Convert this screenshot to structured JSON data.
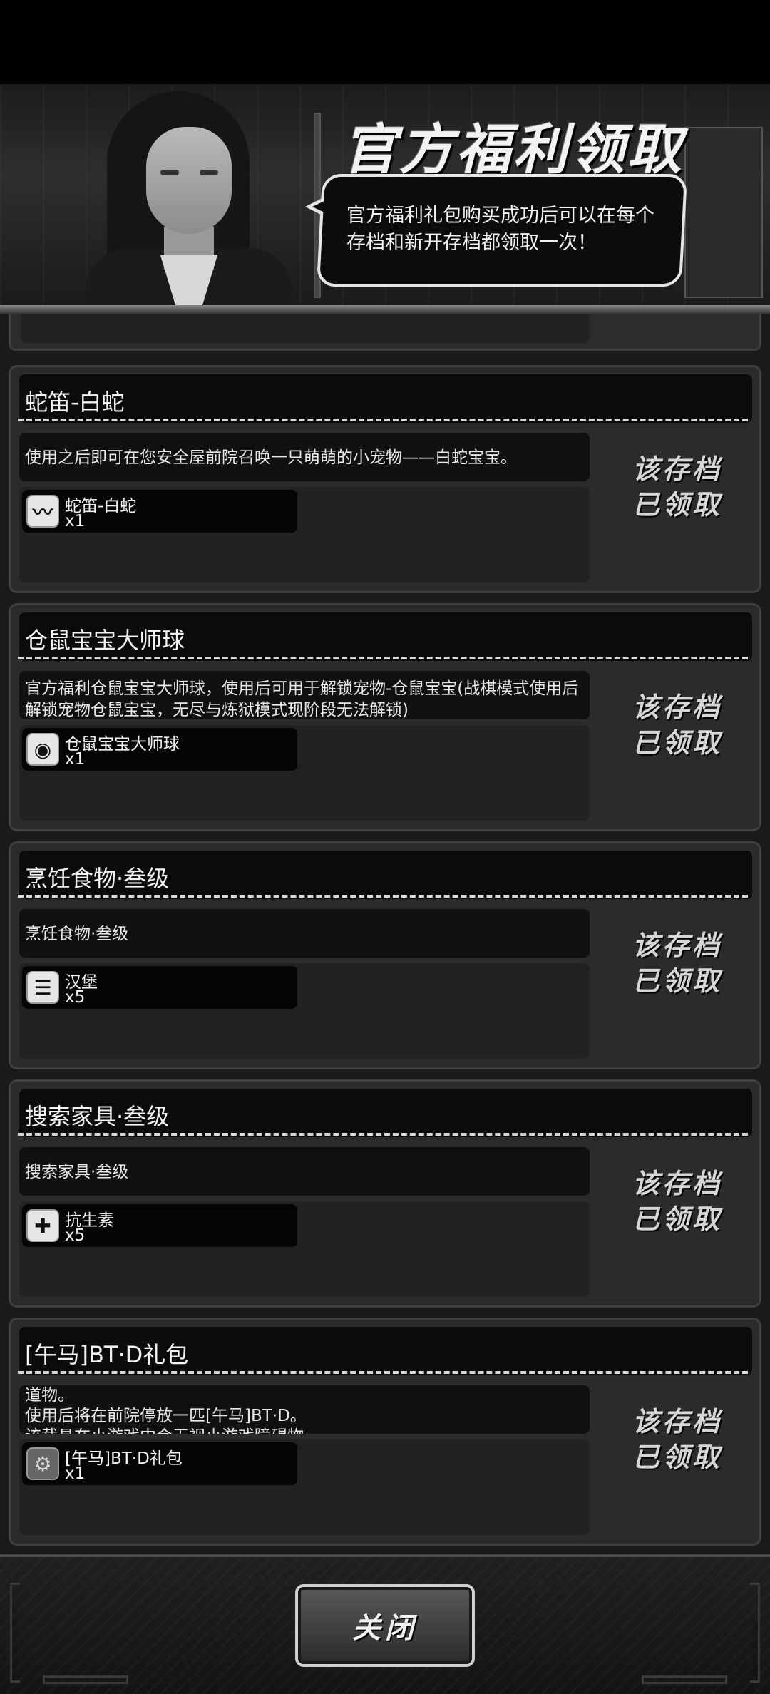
{
  "header": {
    "title": "官方福利领取",
    "bubble_text": "官方福利礼包购买成功后可以在每个存档和新开存档都领取一次！"
  },
  "cards": [
    {
      "title": "蛇笛-白蛇",
      "description": "使用之后即可在您安全屋前院召唤一只萌萌的小宠物——白蛇宝宝。",
      "item": {
        "name": "蛇笛-白蛇",
        "count": "x1",
        "icon": "snake-flute-icon"
      },
      "status": "该存档已领取"
    },
    {
      "title": "仓鼠宝宝大师球",
      "description": "官方福利仓鼠宝宝大师球，使用后可用于解锁宠物-仓鼠宝宝(战棋模式使用后解锁宠物仓鼠宝宝，无尽与炼狱模式现阶段无法解锁)",
      "item": {
        "name": "仓鼠宝宝大师球",
        "count": "x1",
        "icon": "master-ball-icon"
      },
      "status": "该存档已领取"
    },
    {
      "title": "烹饪食物·叁级",
      "description": "烹饪食物·叁级",
      "item": {
        "name": "汉堡",
        "count": "x5",
        "icon": "burger-icon"
      },
      "status": "该存档已领取"
    },
    {
      "title": "搜索家具·叁级",
      "description": "搜索家具·叁级",
      "item": {
        "name": "抗生素",
        "count": "x5",
        "icon": "antibiotic-icon"
      },
      "status": "该存档已领取"
    },
    {
      "title": "[午马]BT·D礼包",
      "description": "道物。\n使用后将在前院停放一匹[午马]BT·D。\n该载具在小游戏中会无视小游戏障碍物",
      "item": {
        "name": "[午马]BT·D礼包",
        "count": "x1",
        "icon": "vehicle-icon"
      },
      "status": "该存档已领取"
    }
  ],
  "footer": {
    "close_label": "关闭"
  }
}
